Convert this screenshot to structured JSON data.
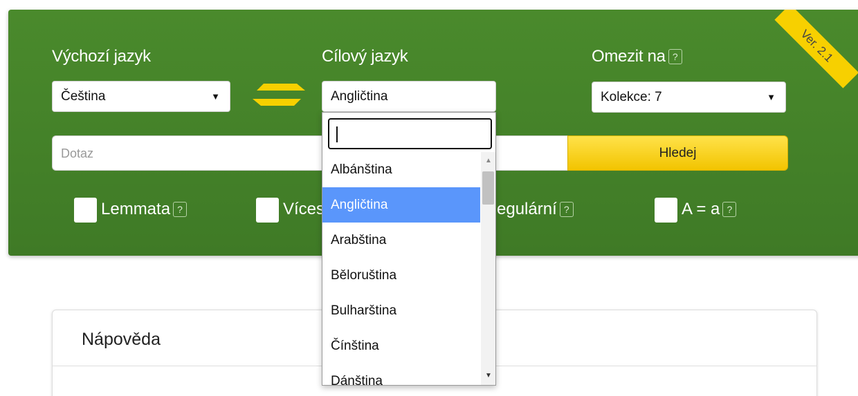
{
  "version_ribbon": "Ver. 2.1",
  "source_lang": {
    "label": "Výchozí jazyk",
    "value": "Čeština"
  },
  "target_lang": {
    "label": "Cílový jazyk",
    "value": "Angličtina"
  },
  "restrict": {
    "label": "Omezit na",
    "help": "?",
    "value": "Kolekce: 7"
  },
  "query": {
    "placeholder": "Dotaz",
    "button": "Hledej"
  },
  "options": {
    "lemmata": {
      "label": "Lemmata",
      "help": "?"
    },
    "multi": {
      "label": "Víces"
    },
    "regular": {
      "label": "egulární",
      "help": "?"
    },
    "case": {
      "label": "A = a",
      "help": "?"
    }
  },
  "dropdown": {
    "search_value": "",
    "items": [
      "Albánština",
      "Angličtina",
      "Arabština",
      "Běloruština",
      "Bulharština",
      "Čínština",
      "Dánština"
    ],
    "selected_index": 1
  },
  "help": {
    "title": "Nápověda"
  },
  "colors": {
    "panel": "#437f28",
    "accent": "#f7d000",
    "selected": "#5a96fb"
  }
}
